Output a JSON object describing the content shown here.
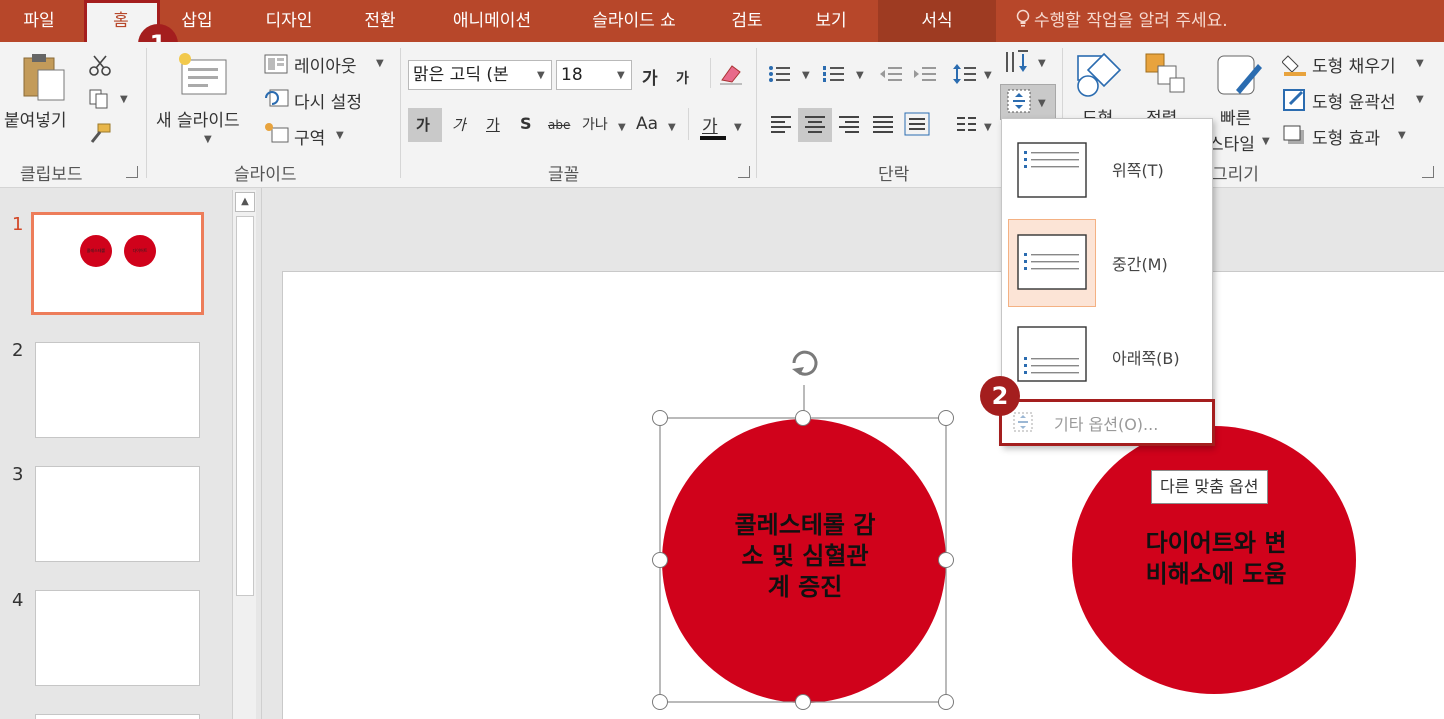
{
  "tabs": {
    "file": "파일",
    "home": "홈",
    "insert": "삽입",
    "design": "디자인",
    "transitions": "전환",
    "animations": "애니메이션",
    "slideshow": "슬라이드 쇼",
    "review": "검토",
    "view": "보기",
    "format": "서식",
    "tell_me": "수행할 작업을 알려 주세요."
  },
  "ribbon": {
    "clipboard": {
      "paste": "붙여넣기",
      "group": "클립보드"
    },
    "slides": {
      "new_slide": "새 슬라이드",
      "layout": "레이아웃",
      "reset": "다시 설정",
      "section": "구역",
      "group": "슬라이드"
    },
    "font": {
      "font_name": "맑은 고딕 (본",
      "font_size": "18",
      "bold": "가",
      "italic": "가",
      "underline": "가",
      "shadow": "S",
      "strike": "abe",
      "spacing": "가나",
      "case": "Aa",
      "color": "가",
      "grow": "가",
      "shrink": "가",
      "group": "글꼴"
    },
    "paragraph": {
      "group": "단락"
    },
    "drawing": {
      "shapes": "도형",
      "arrange": "정렬",
      "quick_styles_1": "빠른",
      "quick_styles_2": "스타일",
      "fill": "도형 채우기",
      "outline": "도형 윤곽선",
      "effects": "도형 효과",
      "group": "그리기"
    }
  },
  "thumbnails": {
    "numbers": [
      "1",
      "2",
      "3",
      "4"
    ],
    "thumb1_labels": [
      "콜레스테롤",
      "다이어트"
    ]
  },
  "slide": {
    "shape1_text": "콜레스테롤 감\n소 및 심혈관\n계 증진",
    "shape2_text": "다이어트와 변\n비해소에 도움",
    "shape_color": "#d0021b"
  },
  "align_menu": {
    "top": "위쪽(T)",
    "middle": "중간(M)",
    "bottom": "아래쪽(B)",
    "more": "기타 옵션(O)...",
    "tooltip": "다른 맞춤 옵션"
  },
  "callouts": {
    "one": "1",
    "two": "2"
  },
  "colors": {
    "accent": "#b7472a",
    "callout": "#a41e1e",
    "selected_item": "#fce4d6"
  }
}
